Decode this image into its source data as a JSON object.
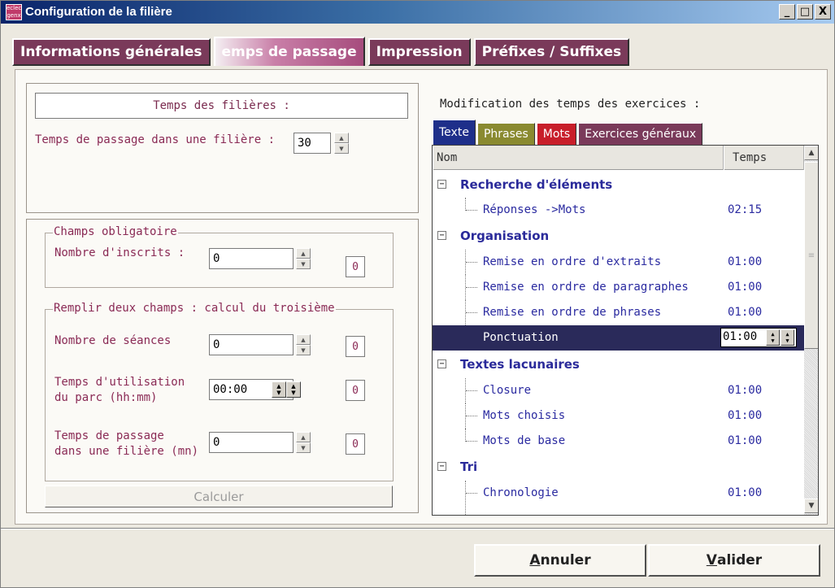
{
  "window": {
    "title": "Configuration de la filière",
    "icon_text": "eclect genx",
    "controls": {
      "minimize": "_",
      "maximize": "□",
      "close": "X"
    }
  },
  "main_tabs": [
    {
      "label": "Informations générales",
      "active": false
    },
    {
      "label": "emps de passage",
      "active": true
    },
    {
      "label": "Impression",
      "active": false
    },
    {
      "label": "Préfixes / Suffixes",
      "active": false
    }
  ],
  "left": {
    "header": "Temps des filières :",
    "passage_label": "Temps de passage dans une filière :",
    "passage_value": "30",
    "mandatory": {
      "legend": "Champs obligatoire",
      "inscrits_label": "Nombre d'inscrits :",
      "inscrits_value": "0",
      "inscrits_result": "0"
    },
    "compute": {
      "legend": "Remplir deux champs : calcul du troisième",
      "seances_label": "Nombre de séances",
      "seances_value": "0",
      "seances_result": "0",
      "parc_label_1": "Temps d'utilisation",
      "parc_label_2": "du parc (hh:mm)",
      "parc_value": "00:00",
      "parc_result": "0",
      "filiere_label_1": "Temps de passage",
      "filiere_label_2": "dans une filière (mn)",
      "filiere_value": "0",
      "filiere_result": "0"
    },
    "calc_button": "Calculer"
  },
  "right": {
    "label": "Modification des temps des exercices :",
    "sub_tabs": [
      {
        "label": "Texte",
        "color": "#1e2f8a",
        "active": true
      },
      {
        "label": "Phrases",
        "color": "#8a8a30",
        "active": false
      },
      {
        "label": "Mots",
        "color": "#c81e2a",
        "active": false
      },
      {
        "label": "Exercices généraux",
        "color": "#7a3a5a",
        "active": false
      }
    ],
    "columns": {
      "name": "Nom",
      "time": "Temps"
    },
    "tree": {
      "g1": {
        "label": "Recherche d'éléments",
        "toggle": "−"
      },
      "g1_i1": {
        "label": "Réponses ->Mots",
        "time": "02:15"
      },
      "g2": {
        "label": "Organisation",
        "toggle": "−"
      },
      "g2_i1": {
        "label": "Remise en ordre d'extraits",
        "time": "01:00"
      },
      "g2_i2": {
        "label": "Remise en ordre de paragraphes",
        "time": "01:00"
      },
      "g2_i3": {
        "label": "Remise en ordre de phrases",
        "time": "01:00"
      },
      "g2_i4": {
        "label": "Ponctuation",
        "time": "01:00"
      },
      "g3": {
        "label": "Textes lacunaires",
        "toggle": "−"
      },
      "g3_i1": {
        "label": "Closure",
        "time": "01:00"
      },
      "g3_i2": {
        "label": "Mots choisis",
        "time": "01:00"
      },
      "g3_i3": {
        "label": "Mots de base",
        "time": "01:00"
      },
      "g4": {
        "label": "Tri",
        "toggle": "−"
      },
      "g4_i1": {
        "label": "Chronologie",
        "time": "01:00"
      }
    }
  },
  "buttons": {
    "cancel_accel": "A",
    "cancel_rest": "nnuler",
    "ok_accel": "V",
    "ok_rest": "alider"
  }
}
